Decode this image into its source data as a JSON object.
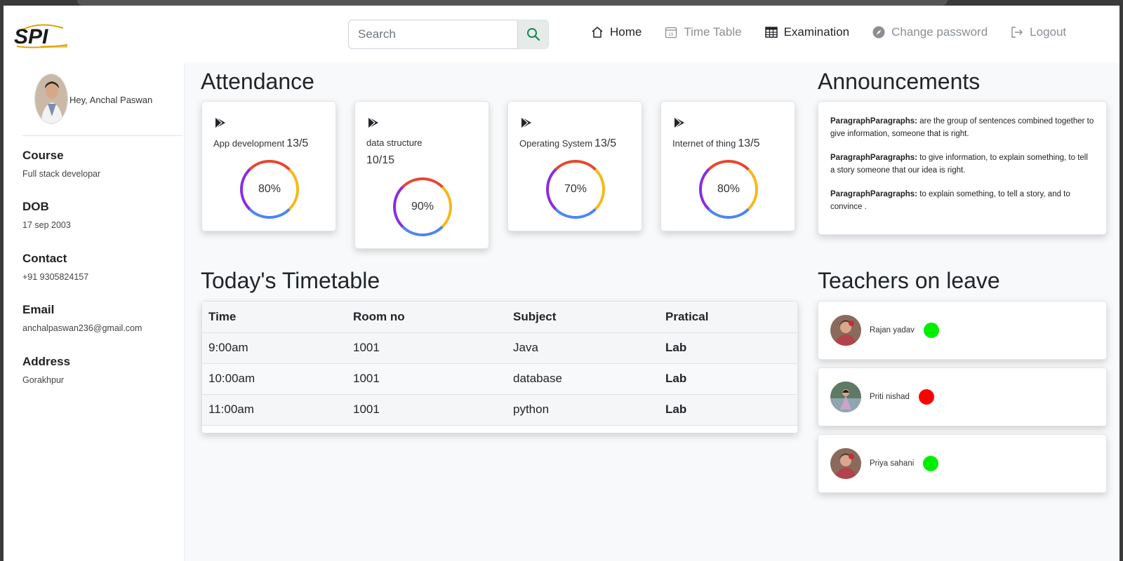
{
  "nav": {
    "logo_text": "SPI",
    "search_placeholder": "Search",
    "links": [
      {
        "label": "Home",
        "icon": "house-icon"
      },
      {
        "label": "Time Table",
        "icon": "calendar-icon"
      },
      {
        "label": "Examination",
        "icon": "table-icon"
      },
      {
        "label": "Change password",
        "icon": "compass-icon"
      },
      {
        "label": "Logout",
        "icon": "logout-icon"
      }
    ]
  },
  "profile": {
    "greeting": "Hey, Anchal Paswan",
    "fields": [
      {
        "label": "Course",
        "value": "Full stack developar"
      },
      {
        "label": "DOB",
        "value": "17 sep 2003"
      },
      {
        "label": "Contact",
        "value": "+91 9305824157"
      },
      {
        "label": "Email",
        "value": "anchalpaswan236@gmail.com"
      },
      {
        "label": "Address",
        "value": "Gorakhpur"
      }
    ]
  },
  "attendance": {
    "title": "Attendance",
    "cards": [
      {
        "subject": "App development",
        "count": "13/5",
        "percent": "80%"
      },
      {
        "subject": "data structure",
        "count": "10/15",
        "percent": "90%"
      },
      {
        "subject": "Operating System",
        "count": "13/5",
        "percent": "70%"
      },
      {
        "subject": "Internet of thing",
        "count": "13/5",
        "percent": "80%"
      }
    ]
  },
  "announcements": {
    "title": "Announcements",
    "items": [
      {
        "bold": "ParagraphParagraphs:",
        "text": " are the group of sentences combined together to give information, someone that is right."
      },
      {
        "bold": "ParagraphParagraphs:",
        "text": " to give information, to explain something, to tell a story someone that our idea is right."
      },
      {
        "bold": "ParagraphParagraphs:",
        "text": " to explain something, to tell a story, and to convince ."
      }
    ]
  },
  "timetable": {
    "title": "Today's Timetable",
    "headers": [
      "Time",
      "Room no",
      "Subject",
      "Pratical"
    ],
    "rows": [
      [
        "9:00am",
        "1001",
        "Java",
        "Lab"
      ],
      [
        "10:00am",
        "1001",
        "database",
        "Lab"
      ],
      [
        "11:00am",
        "1001",
        "python",
        "Lab"
      ]
    ]
  },
  "leave": {
    "title": "Teachers on leave",
    "teachers": [
      {
        "name": "Rajan yadav",
        "status_color": "#00ee00"
      },
      {
        "name": "Priti nishad",
        "status_color": "#ff0000"
      },
      {
        "name": "Priya sahani",
        "status_color": "#00ee00"
      }
    ]
  }
}
